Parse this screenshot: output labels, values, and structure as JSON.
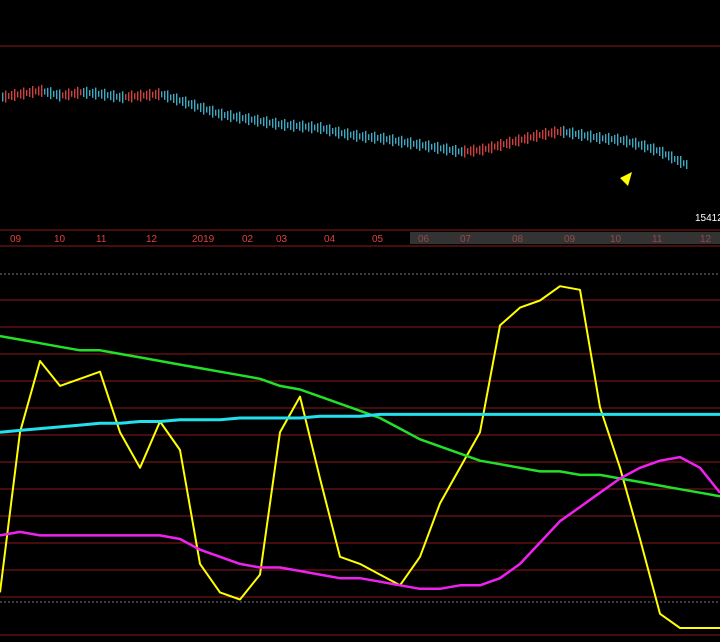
{
  "colors": {
    "background": "#000000",
    "grid_red": "#8a1a1a",
    "grid_dotted": "#777777",
    "candle_up": "#d04040",
    "candle_down": "#40a8c0",
    "axis_text": "#e04040",
    "selection": "#555555",
    "yellow_line": "#ffff00",
    "green_line": "#22e02a",
    "cyan_line": "#22e0ee",
    "magenta_line": "#ee22ee",
    "arrow": "#ffff00"
  },
  "price_label": "15412",
  "month_labels": [
    "09",
    "10",
    "11",
    "12",
    "2019",
    "02",
    "03",
    "04",
    "05",
    "06",
    "07",
    "08",
    "09",
    "10",
    "11",
    "12"
  ],
  "chart_data": {
    "type": "line",
    "x": [
      0,
      20,
      40,
      60,
      80,
      100,
      120,
      140,
      160,
      180,
      200,
      220,
      240,
      260,
      280,
      300,
      320,
      340,
      360,
      380,
      400,
      420,
      440,
      460,
      480,
      500,
      520,
      540,
      560,
      580,
      600,
      620,
      640,
      660,
      680,
      700,
      720
    ],
    "series": [
      {
        "key": "price",
        "values": [
          0.78,
          0.8,
          0.82,
          0.79,
          0.81,
          0.8,
          0.78,
          0.79,
          0.8,
          0.76,
          0.72,
          0.68,
          0.66,
          0.64,
          0.62,
          0.61,
          0.6,
          0.57,
          0.55,
          0.54,
          0.52,
          0.5,
          0.48,
          0.46,
          0.47,
          0.5,
          0.53,
          0.56,
          0.58,
          0.56,
          0.54,
          0.53,
          0.5,
          0.46,
          0.4,
          0.35,
          0.34
        ]
      },
      {
        "key": "yellow",
        "values": [
          0.1,
          0.55,
          0.75,
          0.68,
          0.7,
          0.72,
          0.55,
          0.45,
          0.58,
          0.5,
          0.18,
          0.1,
          0.08,
          0.15,
          0.55,
          0.65,
          0.42,
          0.2,
          0.18,
          0.15,
          0.12,
          0.2,
          0.35,
          0.45,
          0.55,
          0.85,
          0.9,
          0.92,
          0.96,
          0.95,
          0.62,
          0.45,
          0.25,
          0.04,
          0.0,
          0.0,
          0.0
        ]
      },
      {
        "key": "green",
        "values": [
          0.82,
          0.81,
          0.8,
          0.79,
          0.78,
          0.78,
          0.77,
          0.76,
          0.75,
          0.74,
          0.73,
          0.72,
          0.71,
          0.7,
          0.68,
          0.67,
          0.65,
          0.63,
          0.61,
          0.59,
          0.56,
          0.53,
          0.51,
          0.49,
          0.47,
          0.46,
          0.45,
          0.44,
          0.44,
          0.43,
          0.43,
          0.42,
          0.41,
          0.4,
          0.39,
          0.38,
          0.37
        ]
      },
      {
        "key": "cyan",
        "values": [
          0.55,
          0.555,
          0.56,
          0.565,
          0.57,
          0.575,
          0.575,
          0.58,
          0.58,
          0.585,
          0.585,
          0.585,
          0.59,
          0.59,
          0.59,
          0.59,
          0.595,
          0.595,
          0.595,
          0.6,
          0.6,
          0.6,
          0.6,
          0.6,
          0.6,
          0.6,
          0.6,
          0.6,
          0.6,
          0.6,
          0.6,
          0.6,
          0.6,
          0.6,
          0.6,
          0.6,
          0.6
        ]
      },
      {
        "key": "magenta",
        "values": [
          0.26,
          0.27,
          0.26,
          0.26,
          0.26,
          0.26,
          0.26,
          0.26,
          0.26,
          0.25,
          0.22,
          0.2,
          0.18,
          0.17,
          0.17,
          0.16,
          0.15,
          0.14,
          0.14,
          0.13,
          0.12,
          0.11,
          0.11,
          0.12,
          0.12,
          0.14,
          0.18,
          0.24,
          0.3,
          0.34,
          0.38,
          0.42,
          0.45,
          0.47,
          0.48,
          0.45,
          0.38
        ]
      }
    ]
  }
}
